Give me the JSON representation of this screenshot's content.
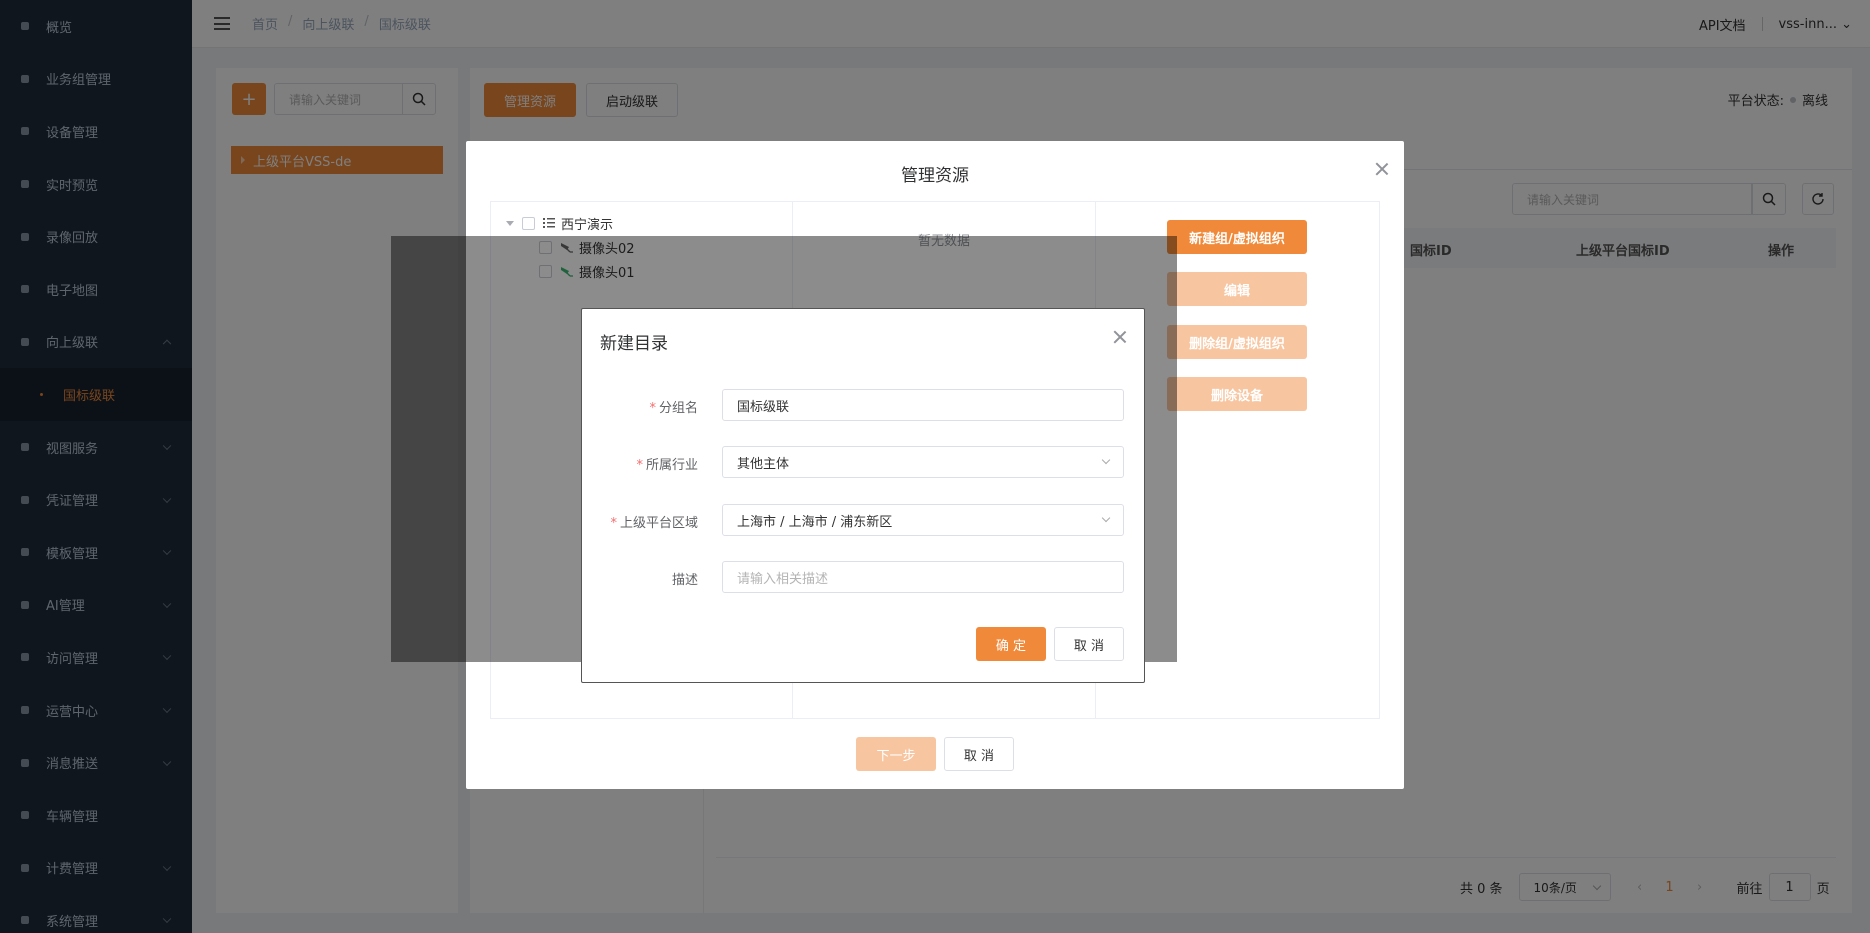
{
  "sidebar": {
    "items": [
      {
        "label": "概览",
        "icon": "overview-icon"
      },
      {
        "label": "业务组管理",
        "icon": "org-icon"
      },
      {
        "label": "设备管理",
        "icon": "device-icon"
      },
      {
        "label": "实时预览",
        "icon": "camera-icon"
      },
      {
        "label": "录像回放",
        "icon": "video-icon"
      },
      {
        "label": "电子地图",
        "icon": "map-icon"
      },
      {
        "label": "向上级联",
        "icon": "cascade-icon",
        "expanded": true
      },
      {
        "label": "国标级联",
        "icon": "dot",
        "sub": true,
        "active": true
      },
      {
        "label": "视图服务",
        "icon": "view-icon"
      },
      {
        "label": "凭证管理",
        "icon": "key-icon"
      },
      {
        "label": "模板管理",
        "icon": "template-icon"
      },
      {
        "label": "AI管理",
        "icon": "ai-icon"
      },
      {
        "label": "访问管理",
        "icon": "user-icon"
      },
      {
        "label": "运营中心",
        "icon": "building-icon"
      },
      {
        "label": "消息推送",
        "icon": "mail-icon"
      },
      {
        "label": "车辆管理",
        "icon": "car-icon"
      },
      {
        "label": "计费管理",
        "icon": "billing-icon"
      },
      {
        "label": "系统管理",
        "icon": "gear-icon"
      }
    ]
  },
  "header": {
    "breadcrumb": [
      "首页",
      "向上级联",
      "国标级联"
    ],
    "api_doc": "API文档",
    "user": "vss-inn..."
  },
  "left_panel": {
    "search_placeholder": "请输入关键词",
    "tree_node": "上级平台VSS-de"
  },
  "right_panel": {
    "manage_btn": "管理资源",
    "start_btn": "启动级联",
    "status_label": "平台状态:",
    "status_value": "离线",
    "search_placeholder": "请输入关键词",
    "columns": [
      "国标ID",
      "上级平台国标ID",
      "操作"
    ],
    "pager": {
      "total": "共 0 条",
      "page_size": "10条/页",
      "current": "1",
      "goto_label": "前往",
      "goto_value": "1",
      "page_unit": "页"
    }
  },
  "manage_dialog": {
    "title": "管理资源",
    "tree": {
      "root": "西宁演示",
      "children": [
        "摄像头02",
        "摄像头01"
      ]
    },
    "empty_text": "暂无数据",
    "buttons": [
      "新建组/虚拟组织",
      "编辑",
      "删除组/虚拟组织",
      "删除设备"
    ],
    "next_btn": "下一步",
    "cancel_btn": "取 消"
  },
  "new_dir_dialog": {
    "title": "新建目录",
    "fields": {
      "group_name": {
        "label": "分组名",
        "value": "国标级联",
        "required": true
      },
      "industry": {
        "label": "所属行业",
        "value": "其他主体",
        "required": true
      },
      "region": {
        "label": "上级平台区域",
        "value": "上海市 / 上海市 / 浦东新区",
        "required": true
      },
      "desc": {
        "label": "描述",
        "placeholder": "请输入相关描述",
        "required": false
      }
    },
    "ok_btn": "确 定",
    "cancel_btn": "取 消"
  },
  "colors": {
    "accent": "#f08a3a",
    "accent_disabled": "#f7c5a0",
    "sidebar_bg": "#1f2d3d",
    "camera_green": "#3cb371"
  }
}
